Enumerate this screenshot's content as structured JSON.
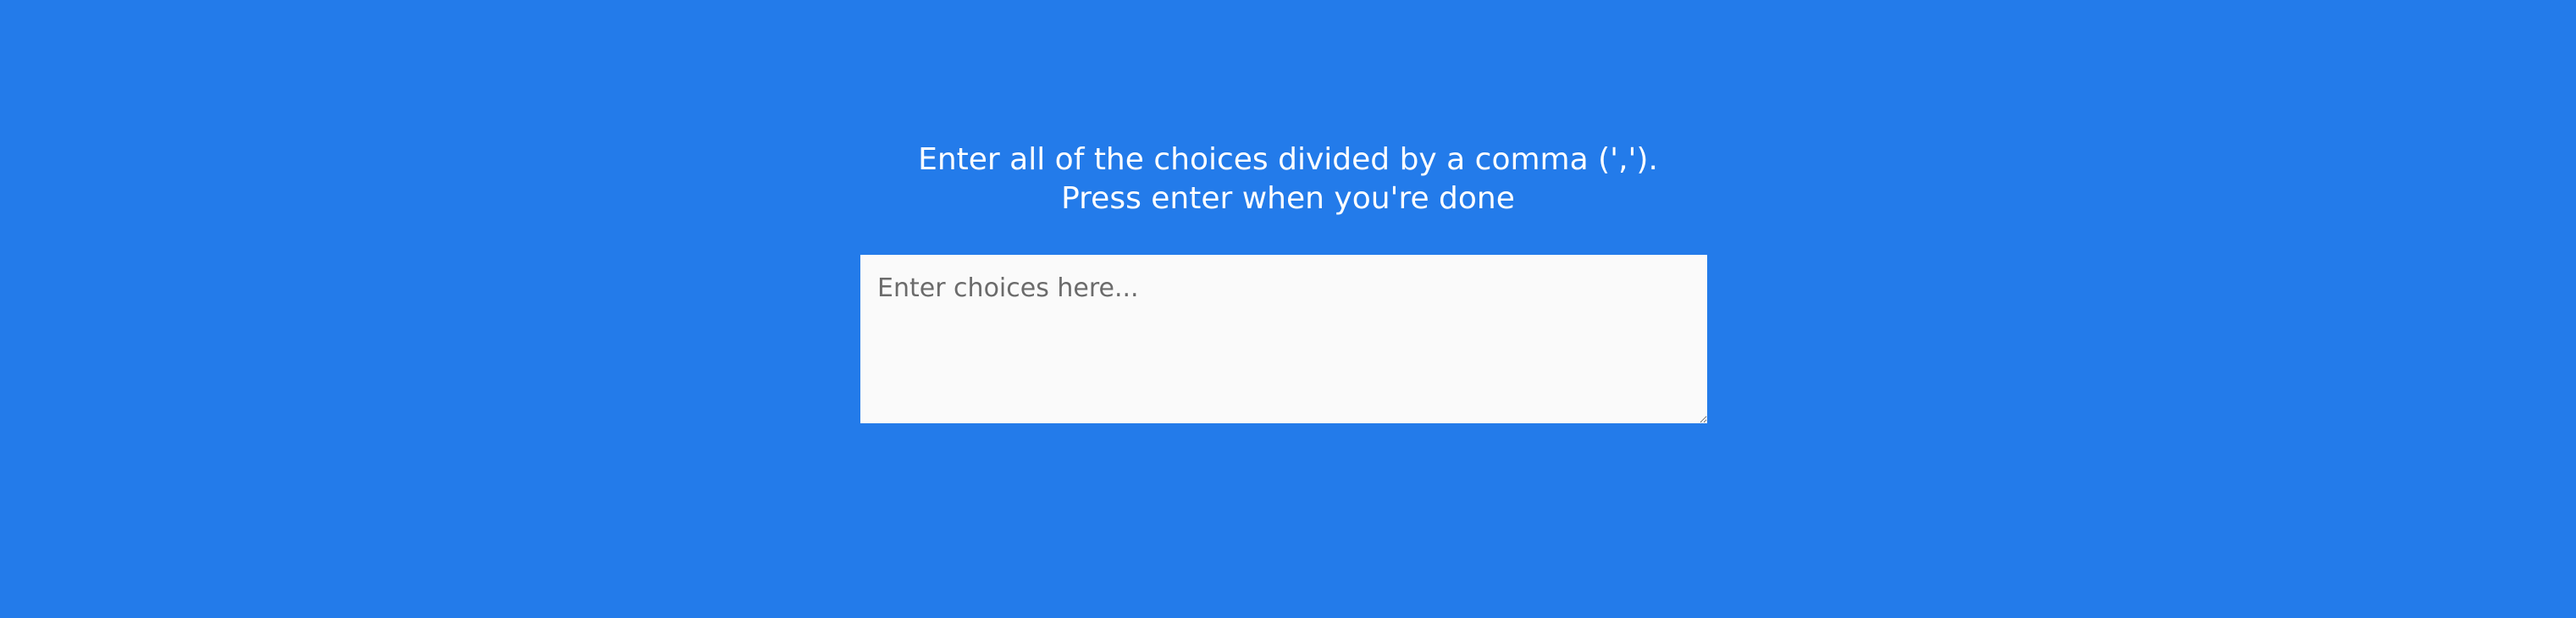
{
  "prompt": {
    "line1": "Enter all of the choices divided by a comma (',').",
    "line2": "Press enter when you're done"
  },
  "choices_input": {
    "placeholder": "Enter choices here...",
    "value": ""
  },
  "colors": {
    "background": "#237bea",
    "text": "#ffffff",
    "input_background": "#fafafa"
  }
}
